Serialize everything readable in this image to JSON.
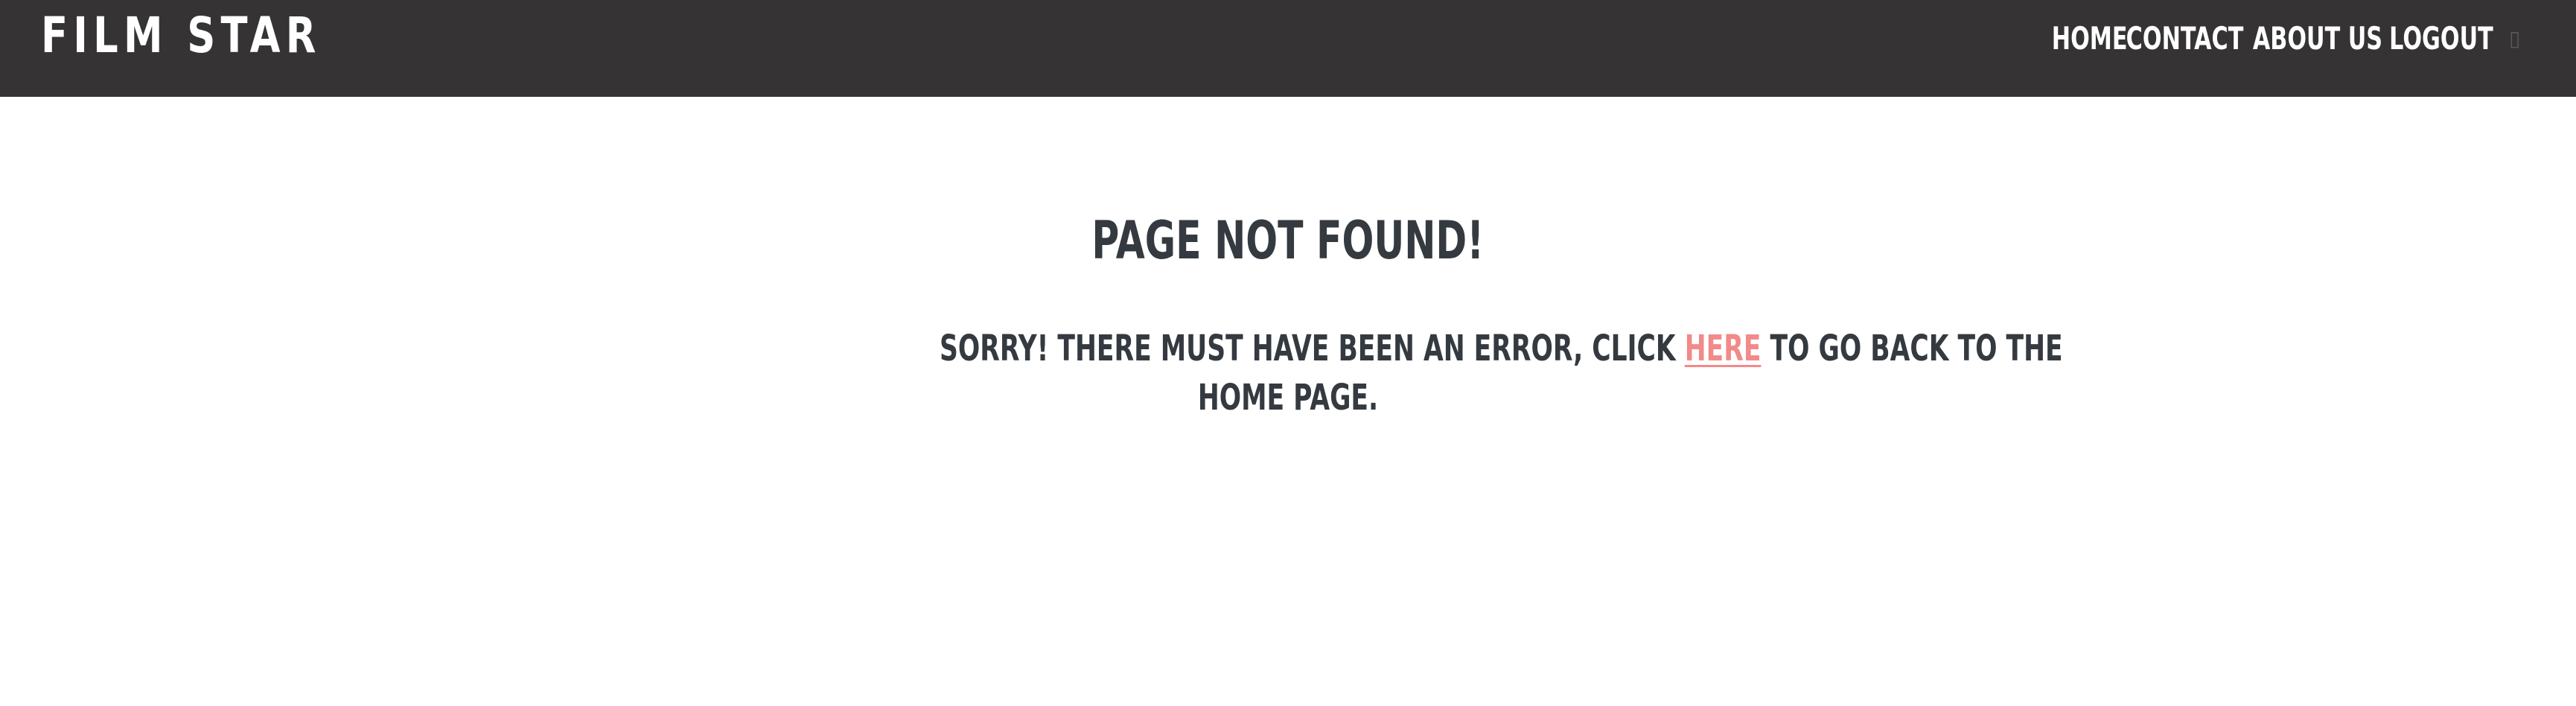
{
  "header": {
    "brand": "FILM STAR",
    "nav": [
      {
        "label": "HOME"
      },
      {
        "label": "CONTACT"
      },
      {
        "label": "ABOUT US"
      },
      {
        "label": "LOGOUT"
      }
    ]
  },
  "main": {
    "title": "PAGE NOT FOUND!",
    "message_before": "SORRY! THERE MUST HAVE BEEN AN ERROR, CLICK",
    "link_text": "HERE",
    "message_after_line1": "TO GO BACK TO THE",
    "message_line2": "HOME PAGE."
  },
  "colors": {
    "navbar_bg": "#353334",
    "nav_text": "#ffffff",
    "body_text": "#343a40",
    "link": "#f28a8a",
    "page_bg": "#ffffff"
  }
}
